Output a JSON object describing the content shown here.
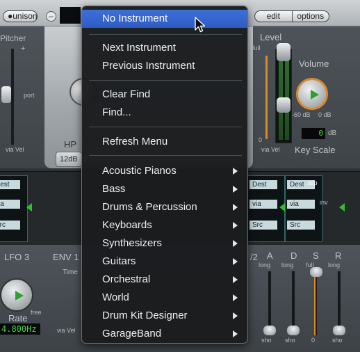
{
  "synth": {
    "unison_label": "●unison",
    "edit_label": "edit",
    "options_label": "options",
    "minus_label": "–",
    "pitcher_label": "Pitcher",
    "port_label": "port",
    "via_vel_label_1": "via Vel",
    "plus_label": "+",
    "level_label": "Level",
    "full_label": "full",
    "volume_label": "Volume",
    "db_min_label": "-60 dB",
    "db_max_label": "0 dB",
    "zero_label": "0",
    "keyscale_value": "0",
    "db_unit": "dB",
    "via_vel_label_2": "via Vel",
    "keyscale_label": "Key Scale",
    "hp_label": "HP",
    "db12_label": "12dB",
    "mod_dest_label": "Dest",
    "mod_bp_label": "b/p",
    "mod_via_label": "via",
    "mod_inv_label": "inv",
    "mod_src_label": "Src",
    "lfo3_label": "LFO 3",
    "env1_label": "ENV 1",
    "time_label": "Time",
    "free_label": "free",
    "rate_label": "Rate",
    "rate_value": "4.800Hz",
    "via_vel_label_3": "via Vel",
    "v2_label": "/2",
    "adsr_labels": [
      "A",
      "D",
      "S",
      "R"
    ],
    "long_label": "long",
    "full_label_2": "full",
    "short_label": "sho"
  },
  "menu": {
    "items": [
      {
        "label": "No Instrument",
        "selected": true
      },
      {
        "label": "Next Instrument"
      },
      {
        "label": "Previous Instrument"
      },
      {
        "label": "Clear Find"
      },
      {
        "label": "Find..."
      },
      {
        "label": "Refresh Menu"
      },
      {
        "label": "Acoustic Pianos",
        "submenu": true
      },
      {
        "label": "Bass",
        "submenu": true
      },
      {
        "label": "Drums & Percussion",
        "submenu": true
      },
      {
        "label": "Keyboards",
        "submenu": true
      },
      {
        "label": "Synthesizers",
        "submenu": true
      },
      {
        "label": "Guitars",
        "submenu": true
      },
      {
        "label": "Orchestral",
        "submenu": true
      },
      {
        "label": "World",
        "submenu": true
      },
      {
        "label": "Drum Kit Designer",
        "submenu": true
      },
      {
        "label": "GarageBand",
        "submenu": true
      }
    ]
  },
  "colors": {
    "menu_highlight": "#3d6fd8",
    "lcd_green": "#4cd44c",
    "accent_orange": "#d98a2a"
  }
}
